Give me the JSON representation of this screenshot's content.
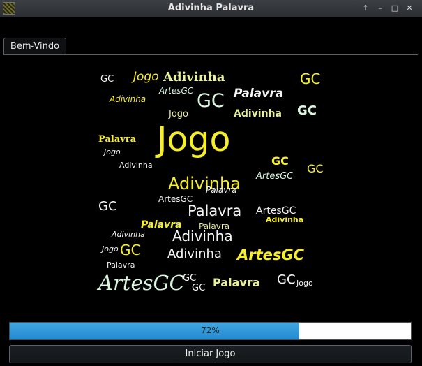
{
  "window": {
    "title": "Adivinha Palavra",
    "controls": [
      "↑",
      "–",
      "□",
      "✕"
    ]
  },
  "tabs": [
    {
      "label": "Bem-Vindo",
      "selected": true
    }
  ],
  "word_cloud": {
    "words": [
      "Jogo",
      "Adivinha",
      "Palavra",
      "ArtesGC",
      "GC"
    ],
    "colors": {
      "yellow": "#f6ee2a",
      "light_yellow": "#e9ef9a",
      "white": "#f4f4f4",
      "mint": "#d9f6df"
    }
  },
  "progress": {
    "value": 72,
    "label": "72%"
  },
  "start_button": {
    "label": "Iniciar Jogo"
  }
}
